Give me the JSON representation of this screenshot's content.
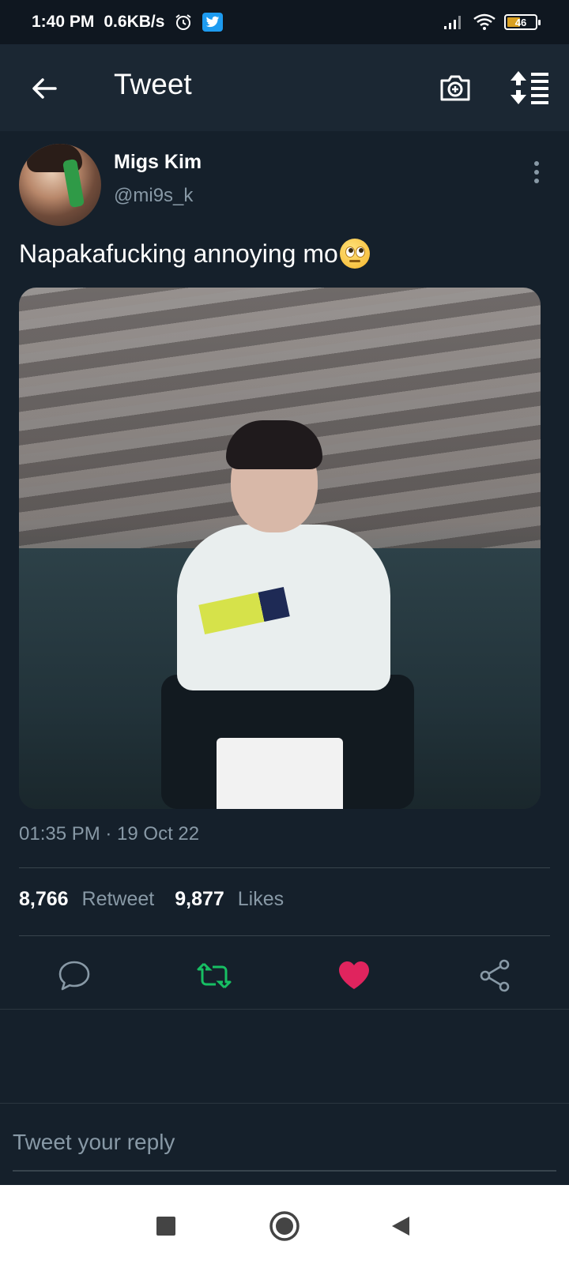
{
  "status_bar": {
    "time": "1:40 PM",
    "speed": "0.6KB/s",
    "battery": "46"
  },
  "app_bar": {
    "title": "Tweet",
    "icons": [
      "back-arrow-icon",
      "camera-add-icon",
      "sort-thread-icon"
    ]
  },
  "tweet": {
    "author_name": "Migs Kim",
    "author_handle": "@mi9s_k",
    "text": "Napakafucking annoying mo",
    "emoji": "face-with-rolling-eyes",
    "timestamp": "01:35 PM · 19 Oct 22",
    "retweets_count": "8,766",
    "retweets_label": "Retweet",
    "likes_count": "9,877",
    "likes_label": "Likes"
  },
  "actions": {
    "retweeted": true,
    "liked": true,
    "colors": {
      "retweet": "#17bf63",
      "like": "#e0245e",
      "muted": "#8899a6"
    }
  },
  "reply": {
    "placeholder": "Tweet your reply"
  },
  "theme": {
    "background": "#15202b",
    "app_bar": "#1b2733",
    "accent": "#1d9bf0"
  }
}
